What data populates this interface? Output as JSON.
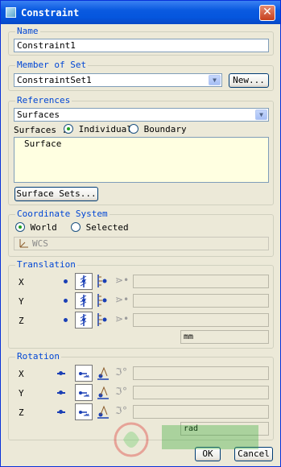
{
  "window": {
    "title": "Constraint"
  },
  "name": {
    "legend": "Name",
    "value": "Constraint1"
  },
  "member": {
    "legend": "Member of Set",
    "value": "ConstraintSet1",
    "new_button": "New..."
  },
  "references": {
    "legend": "References",
    "type_value": "Surfaces",
    "surfaces_label": "Surfaces :",
    "individual_label": "Individual",
    "boundary_label": "Boundary",
    "list_items": [
      "Surface"
    ],
    "surface_sets_button": "Surface Sets..."
  },
  "coordinate_system": {
    "legend": "Coordinate System",
    "world_label": "World",
    "selected_label": "Selected",
    "csys_value": "WCS"
  },
  "translation": {
    "legend": "Translation",
    "axes": [
      "X",
      "Y",
      "Z"
    ],
    "unit": "mm"
  },
  "rotation": {
    "legend": "Rotation",
    "axes": [
      "X",
      "Y",
      "Z"
    ],
    "unit": "rad"
  },
  "footer": {
    "ok_button": "OK",
    "cancel_button": "Cancel"
  },
  "colors": {
    "title_bar": "#0a5ae0",
    "legend_text": "#0046d5",
    "dof_blue": "#1a3fb5"
  }
}
